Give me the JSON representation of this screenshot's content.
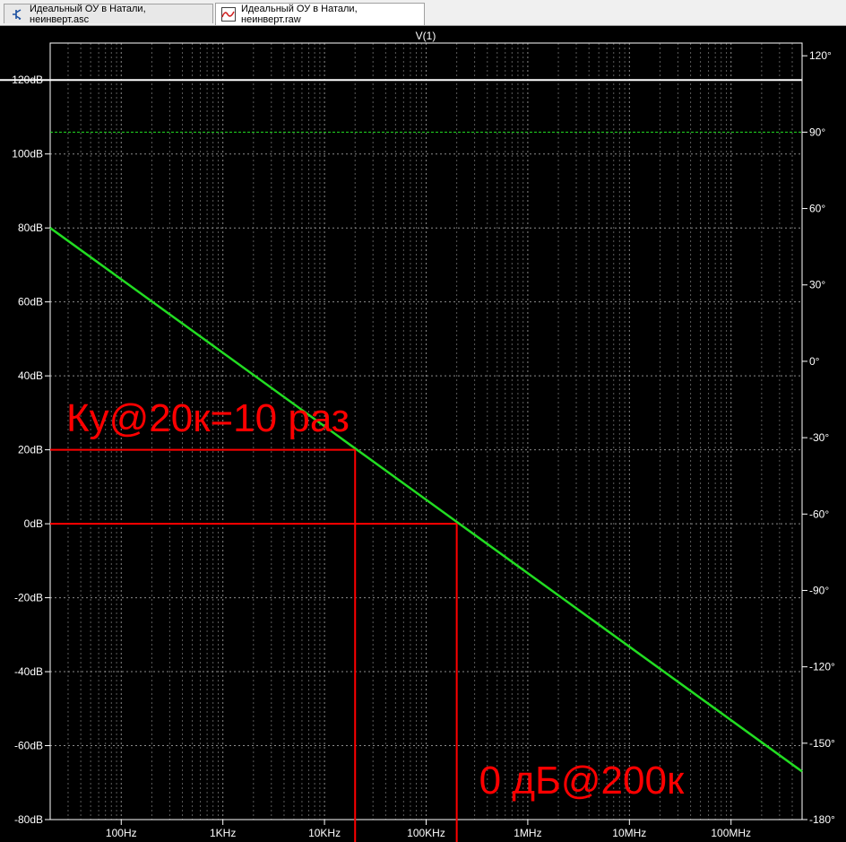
{
  "tabs": [
    {
      "label": "Идеальный ОУ в Натали, неинверт.asc",
      "icon": "schematic-icon",
      "active": false
    },
    {
      "label": "Идеальный ОУ в Натали, неинверт.raw",
      "icon": "waveform-icon",
      "active": true
    }
  ],
  "colors": {
    "background": "#000000",
    "grid": "#9a9a9a",
    "magnitude": "#22dd22",
    "phase": "#22dd22",
    "annotation": "#ff0000",
    "axis": "#ffffff"
  },
  "chart_data": {
    "type": "line",
    "title": "V(1)",
    "x_scale": "log",
    "xlim": [
      20,
      500000000
    ],
    "x_ticks": [
      {
        "value": 100,
        "label": "100Hz"
      },
      {
        "value": 1000,
        "label": "1KHz"
      },
      {
        "value": 10000,
        "label": "10KHz"
      },
      {
        "value": 100000,
        "label": "100KHz"
      },
      {
        "value": 1000000,
        "label": "1MHz"
      },
      {
        "value": 10000000,
        "label": "10MHz"
      },
      {
        "value": 100000000,
        "label": "100MHz"
      }
    ],
    "y_left": {
      "range": [
        -80,
        130
      ],
      "ticks": [
        {
          "value": 120,
          "label": "120dB"
        },
        {
          "value": 100,
          "label": "100dB"
        },
        {
          "value": 80,
          "label": "80dB"
        },
        {
          "value": 60,
          "label": "60dB"
        },
        {
          "value": 40,
          "label": "40dB"
        },
        {
          "value": 20,
          "label": "20dB"
        },
        {
          "value": 0,
          "label": "0dB"
        },
        {
          "value": -20,
          "label": "-20dB"
        },
        {
          "value": -40,
          "label": "-40dB"
        },
        {
          "value": -60,
          "label": "-60dB"
        },
        {
          "value": -80,
          "label": "-80dB"
        }
      ]
    },
    "y_right": {
      "range": [
        -180,
        125
      ],
      "ticks": [
        {
          "value": 120,
          "label": "120°"
        },
        {
          "value": 90,
          "label": "90°"
        },
        {
          "value": 60,
          "label": "60°"
        },
        {
          "value": 30,
          "label": "30°"
        },
        {
          "value": 0,
          "label": "0°"
        },
        {
          "value": -30,
          "label": "-30°"
        },
        {
          "value": -60,
          "label": "-60°"
        },
        {
          "value": -90,
          "label": "-90°"
        },
        {
          "value": -120,
          "label": "-120°"
        },
        {
          "value": -150,
          "label": "-150°"
        },
        {
          "value": -180,
          "label": "-180°"
        }
      ]
    },
    "grid": true,
    "series": [
      {
        "name": "V(1)",
        "kind": "magnitude",
        "axis": "left",
        "x": [
          20,
          500000000
        ],
        "y": [
          80,
          -67
        ]
      },
      {
        "kind": "phase",
        "axis": "right",
        "x": [
          20,
          500000000
        ],
        "y": [
          90,
          90
        ]
      }
    ],
    "reference_lines": [
      {
        "axis": "left",
        "y": 120,
        "color": "#ffffff"
      }
    ],
    "annotations": [
      {
        "text": "Ку@20к=10 раз",
        "x": 20,
        "y": 25
      },
      {
        "text": "0 дБ@200к",
        "x": 200000,
        "y": -73
      }
    ],
    "markers": [
      {
        "x": 20000,
        "y": 20
      },
      {
        "x": 200000,
        "y": 0
      }
    ]
  }
}
